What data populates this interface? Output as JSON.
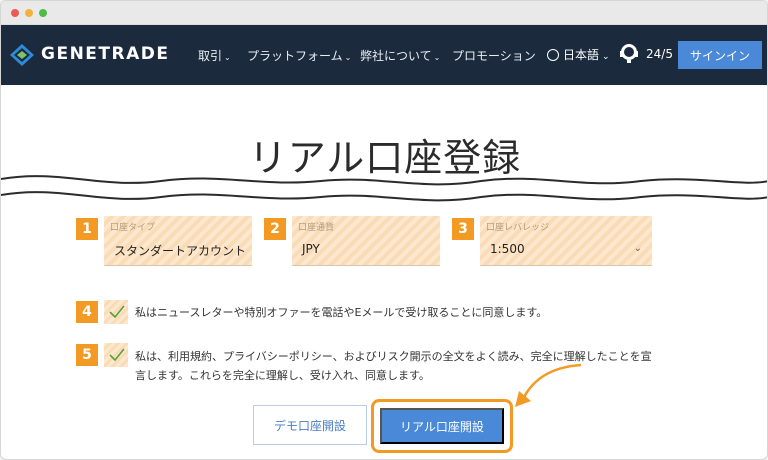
{
  "window": {
    "controls": [
      "close",
      "minimize",
      "maximize"
    ]
  },
  "brand": {
    "name": "GENETRADE",
    "logo_icon": "genetrade-logo-icon"
  },
  "nav": {
    "items": [
      {
        "label": "取引",
        "has_caret": true
      },
      {
        "label": "プラットフォーム",
        "has_caret": true
      },
      {
        "label": "弊社について",
        "has_caret": true
      },
      {
        "label": "プロモーション",
        "has_caret": false
      }
    ],
    "language": "日本語",
    "support": "24/5",
    "signin": "サインイン"
  },
  "page": {
    "title": "リアル口座登録"
  },
  "form": {
    "fields": [
      {
        "step": "1",
        "label": "口座タイプ",
        "value": "スタンダートアカウント"
      },
      {
        "step": "2",
        "label": "口座通貨",
        "value": "JPY"
      },
      {
        "step": "3",
        "label": "口座レバレッジ",
        "value": "1:500",
        "caret": "⌄"
      }
    ],
    "agreements": [
      {
        "step": "4",
        "text": "私はニュースレターや特別オファーを電話やEメールで受け取ることに同意します。",
        "checked": true
      },
      {
        "step": "5",
        "text": "私は、利用規約、プライバシーポリシー、およびリスク開示の全文をよく読み、完全に理解したことを宣言します。これらを完全に理解し、受け入れ、同意します。",
        "checked": true
      }
    ],
    "demo_button": "デモ口座開設",
    "real_button": "リアル口座開設"
  },
  "colors": {
    "navbar": "#1b2b3d",
    "accent": "#4a88d8",
    "highlight": "#f29a24"
  }
}
